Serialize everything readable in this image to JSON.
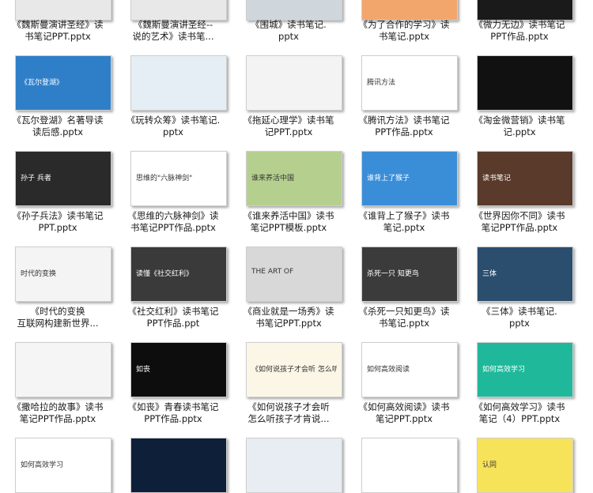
{
  "files": [
    {
      "name": "《魏斯曼演讲圣经》读书笔记PPT.pptx",
      "line1": "《魏斯曼演讲圣经》读",
      "line2": "书笔记PPT.pptx",
      "thumb": "#e8e8e8",
      "text": ""
    },
    {
      "name": "《魏斯曼演讲圣经--说的艺术》读书笔...",
      "line1": "《魏斯曼演讲圣经--",
      "line2": "说的艺术》读书笔...",
      "thumb": "#e8e8e8",
      "text": ""
    },
    {
      "name": "《围城》读书笔记.pptx",
      "line1": "《围城》读书笔记.",
      "line2": "pptx",
      "thumb": "#cfd6dc",
      "text": ""
    },
    {
      "name": "《为了合作的学习》读书笔记.pptx",
      "line1": "《为了合作的学习》读",
      "line2": "书笔记.pptx",
      "thumb": "#f2a66c",
      "text": ""
    },
    {
      "name": "《微力无边》读书笔记PPT作品.pptx",
      "line1": "《微力无边》读书笔记",
      "line2": "PPT作品.pptx",
      "thumb": "#1a1a1a",
      "text": ""
    },
    {
      "name": "《瓦尔登湖》名著导读读后感.pptx",
      "line1": "《瓦尔登湖》名著导读",
      "line2": "读后感.pptx",
      "thumb": "#2f7fc8",
      "text": "《瓦尔登湖》"
    },
    {
      "name": "《玩转众筹》读书笔记.pptx",
      "line1": "《玩转众筹》读书笔记.",
      "line2": "pptx",
      "thumb": "#e4eef4",
      "text": ""
    },
    {
      "name": "《拖延心理学》读书笔记PPT.pptx",
      "line1": "《拖延心理学》读书笔",
      "line2": "记PPT.pptx",
      "thumb": "#f3f3f3",
      "text": ""
    },
    {
      "name": "《腾讯方法》读书笔记PPT作品.pptx",
      "line1": "《腾讯方法》读书笔记",
      "line2": "PPT作品.pptx",
      "thumb": "#ffffff",
      "text": "腾讯方法"
    },
    {
      "name": "《淘金微营销》读书笔记.pptx",
      "line1": "《淘金微营销》读书笔",
      "line2": "记.pptx",
      "thumb": "#111111",
      "text": ""
    },
    {
      "name": "《孙子兵法》读书笔记PPT.pptx",
      "line1": "《孙子兵法》读书笔记",
      "line2": "PPT.pptx",
      "thumb": "#2a2a2a",
      "text": "孙子 兵者"
    },
    {
      "name": "《思维的六脉神剑》读书笔记PPT作品.pptx",
      "line1": "《思维的六脉神剑》读",
      "line2": "书笔记PPT作品.pptx",
      "thumb": "#ffffff",
      "text": "思维的\"六脉神剑\""
    },
    {
      "name": "《谁来养活中国》读书笔记PPT模板.pptx",
      "line1": "《谁来养活中国》读书",
      "line2": "笔记PPT模板.pptx",
      "thumb": "#b5cf8e",
      "text": "谁来养活中国"
    },
    {
      "name": "《谁背上了猴子》读书笔记.pptx",
      "line1": "《谁背上了猴子》读书",
      "line2": "笔记.pptx",
      "thumb": "#3a8ed8",
      "text": "谁背上了猴子"
    },
    {
      "name": "《世界因你不同》读书笔记PPT作品.pptx",
      "line1": "《世界因你不同》读书",
      "line2": "笔记PPT作品.pptx",
      "thumb": "#5a3a2a",
      "text": "读书笔记"
    },
    {
      "name": "《时代的变换 互联网构建新世界...",
      "line1": "《时代的变换",
      "line2": "互联网构建新世界...",
      "thumb": "#f4f4f4",
      "text": "时代的变换"
    },
    {
      "name": "《社交红利》读书笔记PPT作品.ppt",
      "line1": "《社交红利》读书笔记",
      "line2": "PPT作品.ppt",
      "thumb": "#3a3a3a",
      "text": "读懂《社交红利》"
    },
    {
      "name": "《商业就是一场秀》读书笔记PPT.pptx",
      "line1": "《商业就是一场秀》读",
      "line2": "书笔记PPT.pptx",
      "thumb": "#d8d8d8",
      "text": "THE ART OF"
    },
    {
      "name": "《杀死一只知更鸟》读书笔记.pptx",
      "line1": "《杀死一只知更鸟》读",
      "line2": "书笔记.pptx",
      "thumb": "#3b3b3b",
      "text": "杀死一只 知更鸟"
    },
    {
      "name": "《三体》读书笔记.pptx",
      "line1": "《三体》读书笔记.",
      "line2": "pptx",
      "thumb": "#2b4e6e",
      "text": "三体"
    },
    {
      "name": "《撒哈拉的故事》读书笔记PPT作品.pptx",
      "line1": "《撒哈拉的故事》读书",
      "line2": "笔记PPT作品.pptx",
      "thumb": "#f5f5f5",
      "text": ""
    },
    {
      "name": "《如丧》青春读书笔记PPT作品.pptx",
      "line1": "《如丧》青春读书笔记",
      "line2": "PPT作品.pptx",
      "thumb": "#0d0d0d",
      "text": "如丧"
    },
    {
      "name": "《如何说孩子才会听 怎么听孩子才肯说...",
      "line1": "《如何说孩子才会听",
      "line2": "怎么听孩子才肯说...",
      "thumb": "#fbf6e6",
      "text": "《如何说孩子才会听 怎么听孩子才肯说》"
    },
    {
      "name": "《如何高效阅读》读书笔记PPT.pptx",
      "line1": "《如何高效阅读》读书",
      "line2": "笔记PPT.pptx",
      "thumb": "#ffffff",
      "text": "如何高效阅读"
    },
    {
      "name": "《如何高效学习》读书笔记（4）PPT.pptx",
      "line1": "《如何高效学习》读书",
      "line2": "笔记（4）PPT.pptx",
      "thumb": "#1fb89a",
      "text": "如何高效学习"
    },
    {
      "name": "",
      "line1": "",
      "line2": "",
      "thumb": "#ffffff",
      "text": "如何高效学习"
    },
    {
      "name": "",
      "line1": "",
      "line2": "",
      "thumb": "#0e1f3a",
      "text": ""
    },
    {
      "name": "",
      "line1": "",
      "line2": "",
      "thumb": "#e7edf2",
      "text": ""
    },
    {
      "name": "",
      "line1": "",
      "line2": "",
      "thumb": "#ffffff",
      "text": ""
    },
    {
      "name": "",
      "line1": "",
      "line2": "",
      "thumb": "#f7e35a",
      "text": "认同"
    }
  ]
}
